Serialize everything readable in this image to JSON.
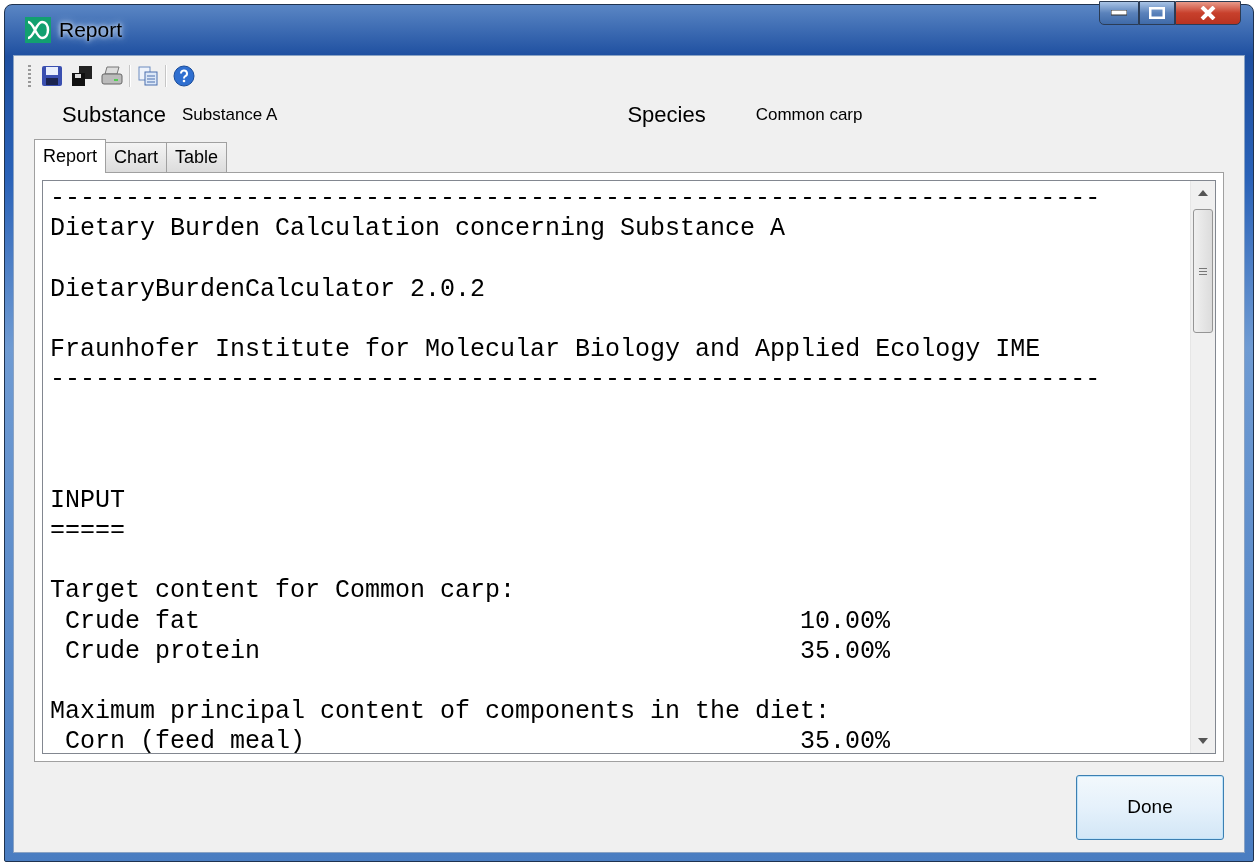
{
  "window": {
    "title": "Report"
  },
  "toolbar": {
    "items": [
      {
        "kind": "save"
      },
      {
        "kind": "save-all"
      },
      {
        "kind": "print"
      },
      {
        "kind": "separator"
      },
      {
        "kind": "copy"
      },
      {
        "kind": "separator"
      },
      {
        "kind": "help"
      }
    ]
  },
  "header": {
    "substance_label": "Substance",
    "substance_value": "Substance A",
    "species_label": "Species",
    "species_value": "Common carp"
  },
  "tabs": [
    {
      "label": "Report",
      "selected": true
    },
    {
      "label": "Chart",
      "selected": false
    },
    {
      "label": "Table",
      "selected": false
    }
  ],
  "report": {
    "lines": [
      {
        "kind": "text",
        "text": "----------------------------------------------------------------------"
      },
      {
        "kind": "text",
        "text": "Dietary Burden Calculation concerning Substance A"
      },
      {
        "kind": "blank"
      },
      {
        "kind": "text",
        "text": "DietaryBurdenCalculator 2.0.2"
      },
      {
        "kind": "blank"
      },
      {
        "kind": "text",
        "text": "Fraunhofer Institute for Molecular Biology and Applied Ecology IME"
      },
      {
        "kind": "text",
        "text": "----------------------------------------------------------------------"
      },
      {
        "kind": "blank"
      },
      {
        "kind": "blank"
      },
      {
        "kind": "blank"
      },
      {
        "kind": "text",
        "text": "INPUT"
      },
      {
        "kind": "text",
        "text": "====="
      },
      {
        "kind": "blank"
      },
      {
        "kind": "text",
        "text": "Target content for Common carp:"
      },
      {
        "kind": "value",
        "text": "Crude fat",
        "value": "10.00%"
      },
      {
        "kind": "value",
        "text": "Crude protein",
        "value": "35.00%"
      },
      {
        "kind": "blank"
      },
      {
        "kind": "text",
        "text": "Maximum principal content of components in the diet:"
      },
      {
        "kind": "value",
        "text": "Corn (feed meal)",
        "value": "35.00%"
      }
    ]
  },
  "buttons": {
    "done": "Done"
  }
}
